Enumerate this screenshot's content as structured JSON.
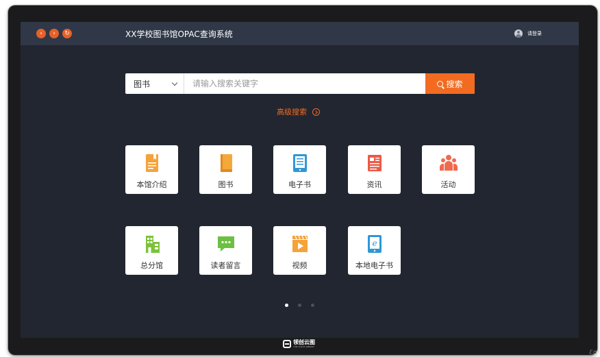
{
  "topbar": {
    "title": "XX学校图书馆OPAC查询系统",
    "nav": [
      {
        "icon": "back-arrow-icon",
        "glyph": "‹"
      },
      {
        "icon": "forward-arrow-icon",
        "glyph": "›"
      },
      {
        "icon": "refresh-icon",
        "glyph": "↻"
      }
    ],
    "login_label": "请登录"
  },
  "search": {
    "type_selected": "图书",
    "placeholder": "请输入搜索关键字",
    "button_label": "搜索"
  },
  "advanced_search": "高级搜索",
  "tiles": [
    {
      "label": "本馆介绍",
      "icon": "library-intro-icon",
      "color": "#f6a23a"
    },
    {
      "label": "图书",
      "icon": "book-icon",
      "color": "#f5a83a"
    },
    {
      "label": "电子书",
      "icon": "ebook-reader-icon",
      "color": "#2f97d6"
    },
    {
      "label": "资讯",
      "icon": "news-icon",
      "color": "#ec5a45"
    },
    {
      "label": "活动",
      "icon": "activity-people-icon",
      "color": "#f06a4f"
    },
    {
      "label": "总分馆",
      "icon": "branch-building-icon",
      "color": "#7cc23b"
    },
    {
      "label": "读者留言",
      "icon": "message-bubble-icon",
      "color": "#6cc041"
    },
    {
      "label": "视频",
      "icon": "video-play-icon",
      "color": "#f6a23a"
    },
    {
      "label": "本地电子书",
      "icon": "local-ebook-icon",
      "color": "#2f97d6"
    }
  ],
  "pagination": {
    "pages": 3,
    "active": 1
  },
  "brand": {
    "name": "领创云图",
    "tagline": "YUN CLOUD LIBRARY"
  },
  "corner_mark": "ℰ∩"
}
